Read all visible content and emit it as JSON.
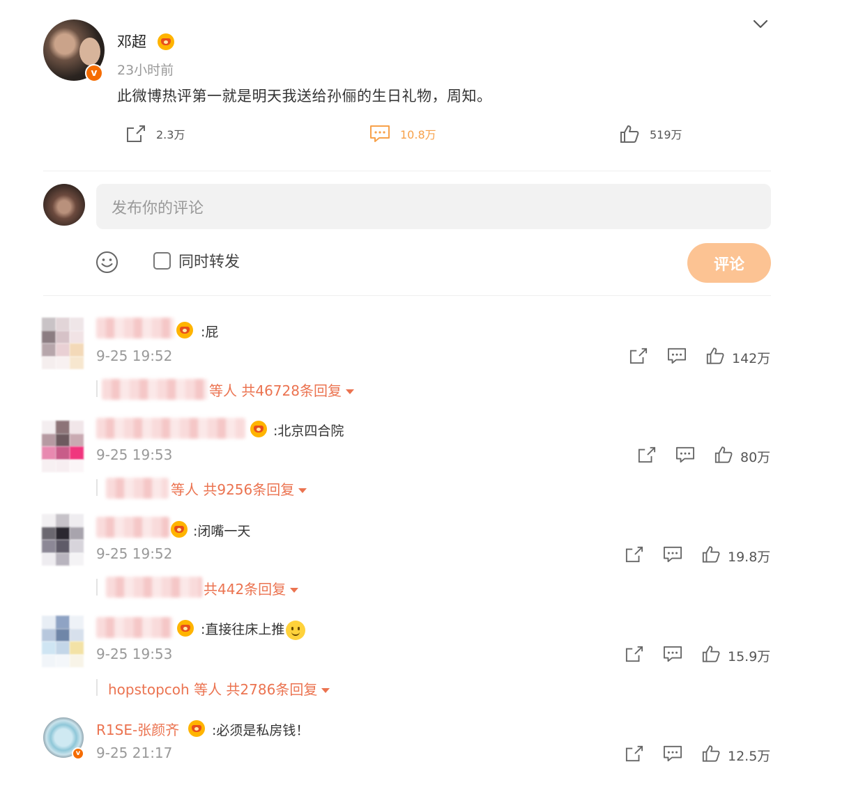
{
  "post": {
    "author": "邓超",
    "time": "23小时前",
    "text": "此微博热评第一就是明天我送给孙俪的生日礼物，周知。",
    "verified_badge": "v",
    "actions": {
      "repost_count": "2.3万",
      "comment_count": "10.8万",
      "like_count": "519万"
    }
  },
  "compose": {
    "placeholder": "发布你的评论",
    "repost_label": "同时转发",
    "submit_label": "评论"
  },
  "comments": [
    {
      "name": "",
      "text": ":屁",
      "time": "9-25 19:52",
      "reply_summary": "等人 共46728条回复",
      "like_count": "142万"
    },
    {
      "name": "",
      "text": ":北京四合院",
      "time": "9-25 19:53",
      "reply_summary": "等人 共9256条回复",
      "like_count": "80万"
    },
    {
      "name": "",
      "text": ":闭嘴一天",
      "time": "9-25 19:52",
      "reply_summary": "共442条回复",
      "like_count": "19.8万"
    },
    {
      "name": "",
      "text": ":直接往床上推",
      "time": "9-25 19:53",
      "reply_user": "hopstopcoh",
      "reply_summary": " 等人 共2786条回复",
      "like_count": "15.9万"
    },
    {
      "name": "R1SE-张颜齐",
      "text": ":必须是私房钱！",
      "time": "9-25 21:17",
      "like_count": "12.5万"
    }
  ],
  "colors": {
    "accent_orange": "#f7a14a",
    "link_orange": "#eb7350",
    "submit_bg": "#fcc393",
    "muted": "#999999",
    "input_bg": "#f2f2f2"
  },
  "icons": [
    "chevron-down-icon",
    "repost-icon",
    "comment-icon",
    "like-icon",
    "emoji-icon",
    "crown-icon",
    "verified-icon"
  ]
}
